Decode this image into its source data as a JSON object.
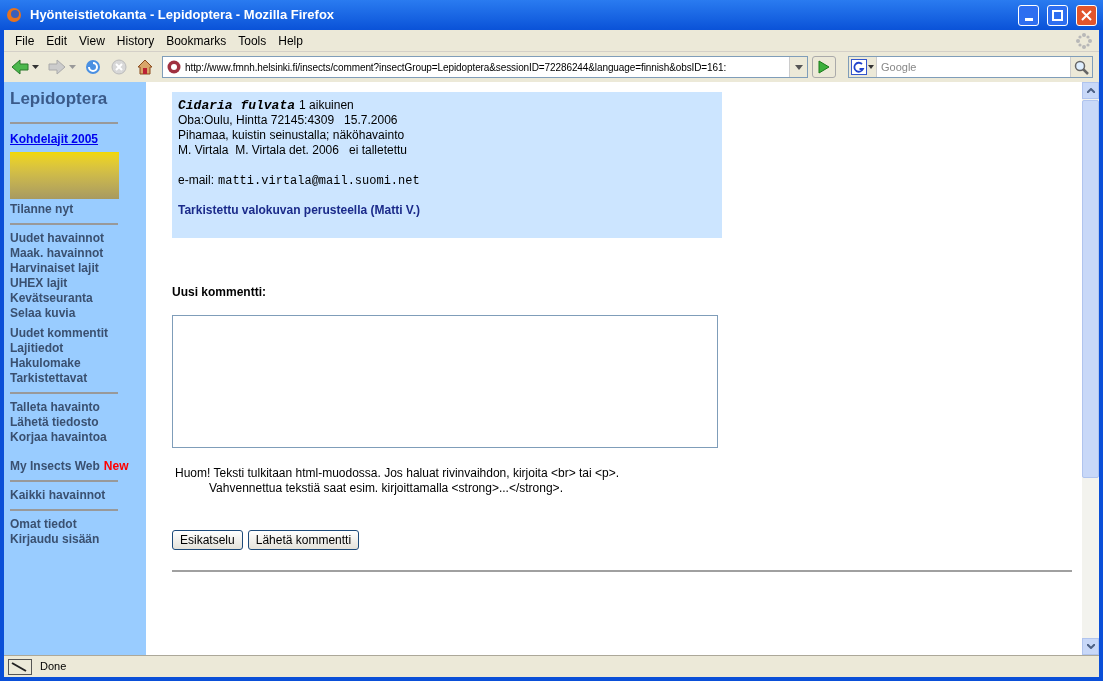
{
  "window": {
    "title": "Hyönteistietokanta - Lepidoptera - Mozilla Firefox"
  },
  "menu": [
    "File",
    "Edit",
    "View",
    "History",
    "Bookmarks",
    "Tools",
    "Help"
  ],
  "address_bar": {
    "url": "http://www.fmnh.helsinki.fi/insects/comment?insectGroup=Lepidoptera&sessionID=72286244&language=finnish&obsID=161:"
  },
  "search": {
    "placeholder": "Google"
  },
  "sidebar": {
    "title": "Lepidoptera",
    "groups": [
      {
        "rule_before": true,
        "items": [
          {
            "kind": "link",
            "label": "Kohdelajit 2005"
          },
          {
            "kind": "image"
          },
          {
            "kind": "item",
            "label": "Tilanne nyt"
          }
        ]
      },
      {
        "rule_before": true,
        "items": [
          {
            "kind": "item",
            "label": "Uudet havainnot"
          },
          {
            "kind": "item",
            "label": "Maak. havainnot"
          },
          {
            "kind": "item",
            "label": "Harvinaiset lajit"
          },
          {
            "kind": "item",
            "label": "UHEX lajit"
          },
          {
            "kind": "item",
            "label": "Kevätseuranta"
          },
          {
            "kind": "item",
            "label": "Selaa kuvia"
          }
        ]
      },
      {
        "rule_before": false,
        "items": [
          {
            "kind": "item",
            "label": "Uudet kommentit"
          },
          {
            "kind": "item",
            "label": "Lajitiedot"
          },
          {
            "kind": "item",
            "label": "Hakulomake"
          },
          {
            "kind": "item",
            "label": "Tarkistettavat"
          }
        ]
      },
      {
        "rule_before": true,
        "items": [
          {
            "kind": "item",
            "label": "Talleta havainto"
          },
          {
            "kind": "item",
            "label": "Lähetä tiedosto"
          },
          {
            "kind": "item",
            "label": "Korjaa havaintoa"
          }
        ]
      },
      {
        "rule_before": false,
        "items": [
          {
            "kind": "item",
            "label": "My Insects Web",
            "badge": "New"
          }
        ]
      },
      {
        "rule_before": true,
        "items": [
          {
            "kind": "item",
            "label": "Kaikki havainnot"
          }
        ]
      },
      {
        "rule_before": true,
        "items": [
          {
            "kind": "item",
            "label": "Omat tiedot"
          },
          {
            "kind": "item",
            "label": "Kirjaudu sisään"
          }
        ]
      }
    ]
  },
  "observation": {
    "species": "Cidaria fulvata",
    "count": "1 aikuinen",
    "lines": [
      "Oba:Oulu, Hintta 72145:4309   15.7.2006",
      "Pihamaa, kuistin seinustalla; näköhavainto",
      "M. Virtala  M. Virtala det. 2006   ei talletettu"
    ],
    "email_label": "e-mail:",
    "email": "matti.virtala@mail.suomi.net",
    "verified": "Tarkistettu valokuvan perusteella (Matti V.)"
  },
  "comment": {
    "label": "Uusi kommentti:",
    "note": [
      "Huom! Teksti tulkitaan html-muodossa. Jos haluat rivinvaihdon, kirjoita <br> tai <p>.",
      "Vahvennettua tekstiä saat esim. kirjoittamalla <strong>...</strong>."
    ],
    "buttons": [
      "Esikatselu",
      "Lähetä kommentti"
    ]
  },
  "status_bar": {
    "text": "Done"
  }
}
